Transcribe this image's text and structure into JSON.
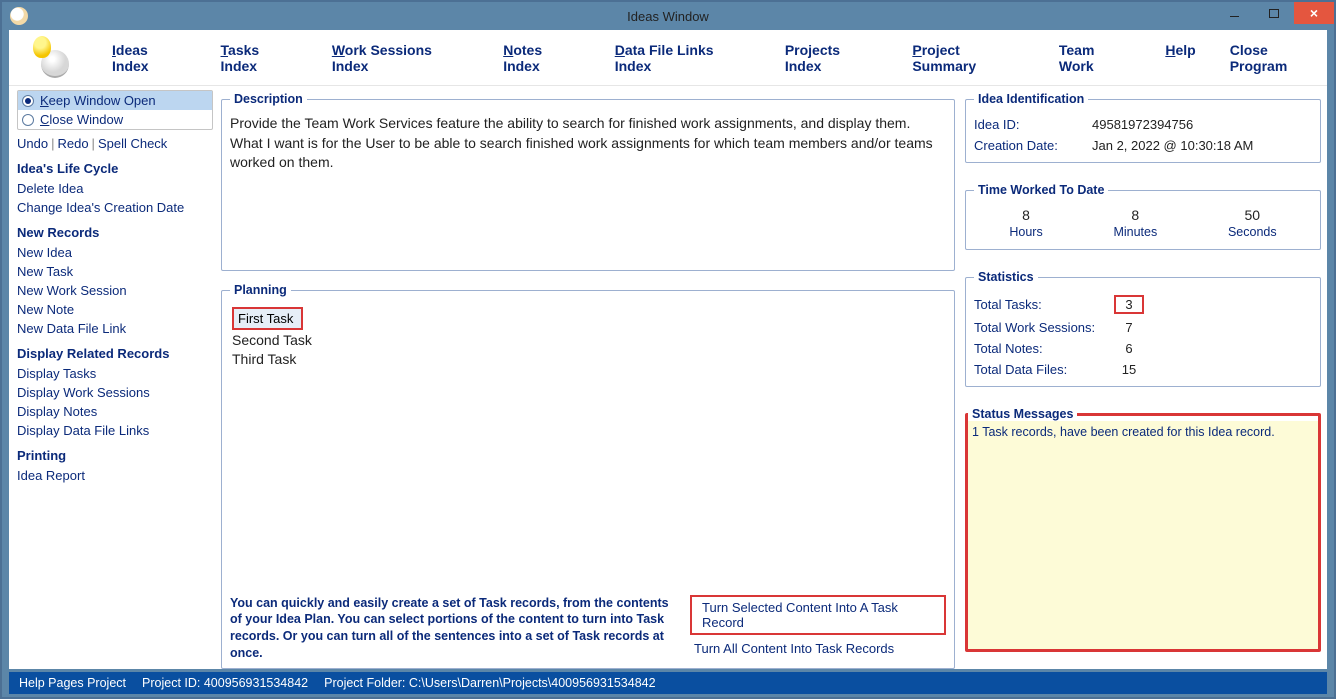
{
  "window": {
    "title": "Ideas Window"
  },
  "nav": {
    "ideas_index": "Ideas Index",
    "ideas_index_u": "I",
    "tasks_index": "Tasks Index",
    "tasks_index_u": "T",
    "ws_index": "Work Sessions Index",
    "ws_index_u": "W",
    "notes_index": "Notes Index",
    "notes_index_u": "N",
    "dfl_index": "Data File Links Index",
    "dfl_index_u": "D",
    "projects_index": "Projects Index",
    "project_summary": "Project Summary",
    "project_summary_u": "P",
    "team_work": "Team Work",
    "help": "Help",
    "help_u": "H",
    "close_program": "Close Program"
  },
  "sidebar": {
    "keep_open": "Keep Window Open",
    "keep_open_u": "K",
    "close_window": "Close Window",
    "close_window_u": "C",
    "undo": "Undo",
    "redo": "Redo",
    "spell": "Spell Check",
    "life_cycle": "Idea's Life Cycle",
    "delete": "Delete Idea",
    "change_date": "Change Idea's Creation Date",
    "new_records": "New Records",
    "new_idea": "New Idea",
    "new_task": "New Task",
    "new_ws": "New Work Session",
    "new_note": "New Note",
    "new_dfl": "New Data File Link",
    "display_related": "Display Related Records",
    "disp_tasks": "Display Tasks",
    "disp_ws": "Display Work Sessions",
    "disp_notes": "Display Notes",
    "disp_dfl": "Display Data File Links",
    "printing": "Printing",
    "idea_report": "Idea Report"
  },
  "description": {
    "legend": "Description",
    "text": "Provide the Team Work Services feature the ability to search for finished work assignments, and display them. What I want is for the User to be able to search finished work assignments for which team members and/or teams worked on them."
  },
  "planning": {
    "legend": "Planning",
    "tasks": {
      "first": "First Task",
      "second": "Second Task",
      "third": "Third Task"
    },
    "helper": "You can quickly and easily create a set of Task records, from the contents of your Idea Plan. You can select portions of the content to turn into Task records. Or you can turn all of the sentences into a set of Task records at once.",
    "btn_selected": "Turn Selected Content Into A Task Record",
    "btn_all": "Turn All Content Into Task Records"
  },
  "ident": {
    "legend": "Idea Identification",
    "id_label": "Idea ID:",
    "id_val": "49581972394756",
    "date_label": "Creation Date:",
    "date_val": "Jan  2, 2022 @ 10:30:18 AM"
  },
  "time": {
    "legend": "Time Worked To Date",
    "hours_v": "8",
    "hours_l": "Hours",
    "mins_v": "8",
    "mins_l": "Minutes",
    "secs_v": "50",
    "secs_l": "Seconds"
  },
  "stats": {
    "legend": "Statistics",
    "tasks_l": "Total Tasks:",
    "tasks_v": "3",
    "ws_l": "Total Work Sessions:",
    "ws_v": "7",
    "notes_l": "Total Notes:",
    "notes_v": "6",
    "files_l": "Total Data Files:",
    "files_v": "15"
  },
  "status": {
    "legend": "Status Messages",
    "line": "1 Task records, have been created for this Idea record."
  },
  "statusbar": {
    "help_proj": "Help Pages Project",
    "project_id": "Project ID:  400956931534842",
    "project_folder": "Project Folder:  C:\\Users\\Darren\\Projects\\400956931534842"
  }
}
